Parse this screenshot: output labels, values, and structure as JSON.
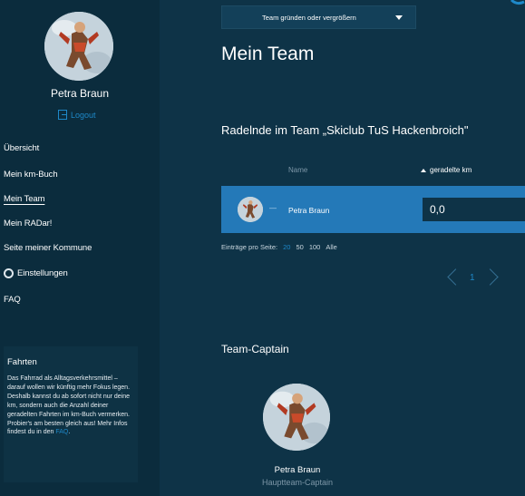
{
  "user": {
    "name": "Petra Braun",
    "logout_label": "Logout"
  },
  "nav": {
    "items": [
      {
        "label": "Übersicht"
      },
      {
        "label": "Mein km-Buch"
      },
      {
        "label": "Mein Team"
      },
      {
        "label": "Mein RADar!"
      },
      {
        "label": "Seite meiner Kommune"
      },
      {
        "label": "Einstellungen",
        "icon": "gear-icon"
      },
      {
        "label": "FAQ"
      }
    ],
    "active": "Mein Team"
  },
  "info_box": {
    "title": "Fahrten",
    "text": "Das Fahrrad als Alltagsverkehrsmittel – darauf wollen wir künftig mehr Fokus legen. Deshalb kannst du ab sofort nicht nur deine km, sondern auch die Anzahl deiner geradelten Fahrten im km-Buch vermerken. Probier's am besten gleich aus! Mehr Infos findest du in den ",
    "link_label": "FAQ",
    "text_end": "."
  },
  "team_select": {
    "label": "Team gründen oder vergrößern"
  },
  "page_title": "Mein Team",
  "section_heading": "Radelnde im Team „Skiclub TuS Hackenbroich\"",
  "table": {
    "columns": {
      "name": "Name",
      "km": "geradelte km"
    },
    "rows": [
      {
        "dash": "—",
        "name": "Petra Braun",
        "km": "0,0"
      }
    ]
  },
  "pagination": {
    "per_page_label": "Einträge pro Seite:",
    "sizes": [
      "20",
      "50",
      "100",
      "Alle"
    ],
    "active_size": "20",
    "current_page": "1"
  },
  "captain": {
    "heading": "Team-Captain",
    "name": "Petra Braun",
    "role": "Hauptteam-Captain"
  },
  "colors": {
    "background": "#0e3347",
    "sidebar": "#0b2c3d",
    "accent": "#1e88c8",
    "row_highlight": "#2479b8"
  }
}
